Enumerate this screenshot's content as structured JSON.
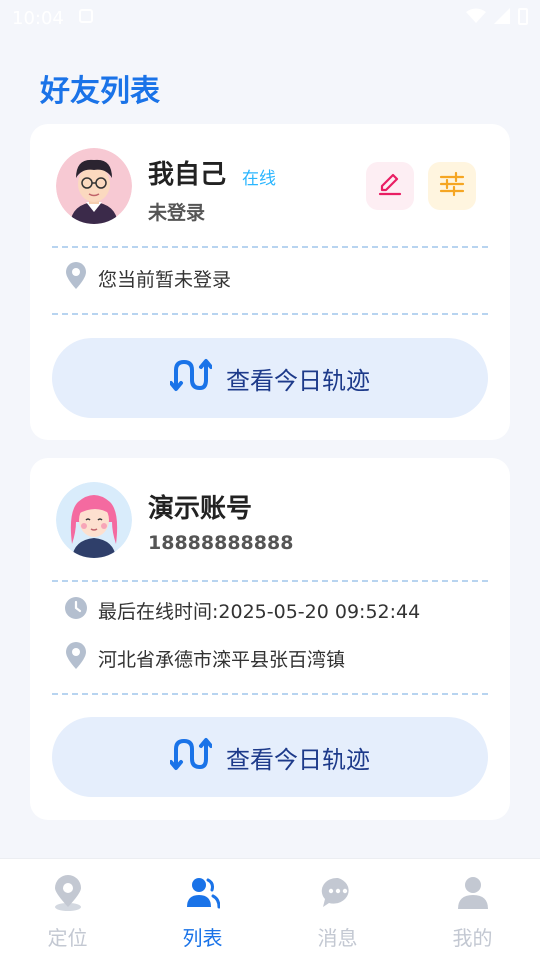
{
  "status_bar": {
    "time": "10:04"
  },
  "page": {
    "title": "好友列表"
  },
  "self_card": {
    "name": "我自己",
    "online_label": "在线",
    "subtitle": "未登录",
    "location_text": "您当前暂未登录",
    "track_button": "查看今日轨迹"
  },
  "demo_card": {
    "name": "演示账号",
    "phone": "18888888888",
    "last_online": "最后在线时间:2025-05-20 09:52:44",
    "location_text": "河北省承德市滦平县张百湾镇",
    "track_button": "查看今日轨迹"
  },
  "tabbar": {
    "tabs": [
      {
        "label": "定位",
        "icon": "location-pin-icon"
      },
      {
        "label": "列表",
        "icon": "friends-icon"
      },
      {
        "label": "消息",
        "icon": "chat-bubble-icon"
      },
      {
        "label": "我的",
        "icon": "user-icon"
      }
    ],
    "active": "列表"
  },
  "colors": {
    "accent": "#1a73e8",
    "online": "#2bb6ff",
    "edit": "#e91e63",
    "settings": "#f5a623",
    "button_bg": "#e5eefc"
  }
}
